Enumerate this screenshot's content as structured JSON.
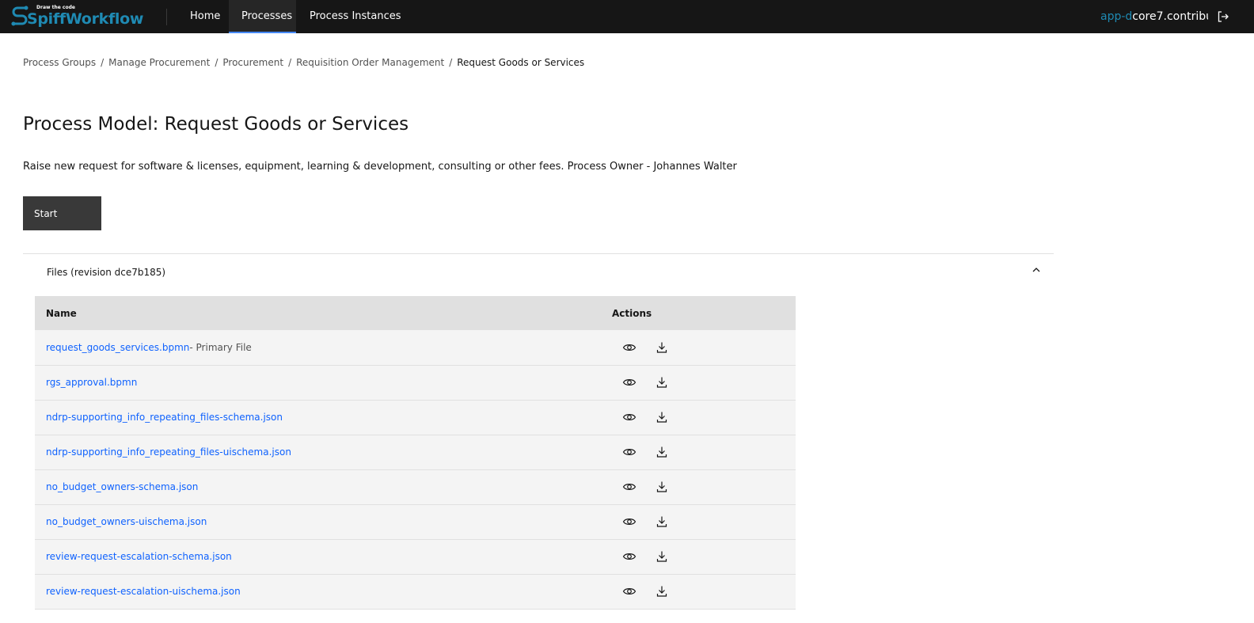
{
  "header": {
    "logo_tagline": "Draw the code",
    "logo_text": "SpiffWorkflow",
    "nav": [
      {
        "label": "Home",
        "active": false
      },
      {
        "label": "Processes",
        "active": true
      },
      {
        "label": "Process Instances",
        "active": false
      }
    ],
    "user_prefix": "app-d",
    "user_suffix": "core7.contribu",
    "logout_icon": "logout-icon"
  },
  "breadcrumb": {
    "items": [
      "Process Groups",
      "Manage Procurement",
      "Procurement",
      "Requisition Order Management"
    ],
    "separator": "/",
    "current": "Request Goods or Services"
  },
  "page": {
    "title": "Process Model: Request Goods or Services",
    "description": "Raise new request for software & licenses, equipment, learning & development, consulting or other fees. Process Owner - Johannes Walter",
    "start_label": "Start"
  },
  "files": {
    "header": "Files (revision dce7b185)",
    "columns": {
      "name": "Name",
      "actions": "Actions"
    },
    "rows": [
      {
        "name": "request_goods_services.bpmn",
        "suffix": "- Primary File"
      },
      {
        "name": "rgs_approval.bpmn",
        "suffix": ""
      },
      {
        "name": "ndrp-supporting_info_repeating_files-schema.json",
        "suffix": ""
      },
      {
        "name": "ndrp-supporting_info_repeating_files-uischema.json",
        "suffix": ""
      },
      {
        "name": "no_budget_owners-schema.json",
        "suffix": ""
      },
      {
        "name": "no_budget_owners-uischema.json",
        "suffix": ""
      },
      {
        "name": "review-request-escalation-schema.json",
        "suffix": ""
      },
      {
        "name": "review-request-escalation-uischema.json",
        "suffix": ""
      }
    ]
  },
  "colors": {
    "accent": "#0f62fe",
    "header_bg": "#161616",
    "brand": "#1f8ab3"
  }
}
